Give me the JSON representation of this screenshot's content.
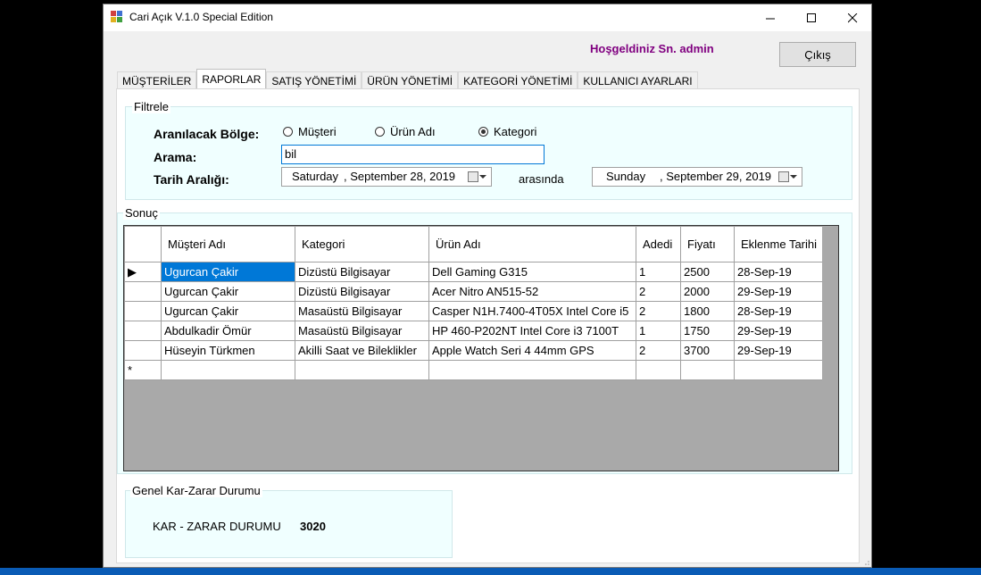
{
  "window": {
    "title": "Cari Açık V.1.0 Special Edition"
  },
  "header": {
    "welcome": "Hoşgeldiniz Sn. admin",
    "exit_label": "Çıkış"
  },
  "tabs": [
    {
      "label": "MÜŞTERİLER"
    },
    {
      "label": "RAPORLAR"
    },
    {
      "label": "SATIŞ YÖNETİMİ"
    },
    {
      "label": "ÜRÜN YÖNETİMİ"
    },
    {
      "label": "KATEGORİ YÖNETİMİ"
    },
    {
      "label": "KULLANICI AYARLARI"
    }
  ],
  "active_tab": "RAPORLAR",
  "filter": {
    "title": "Filtrele",
    "region_label": "Aranılacak Bölge:",
    "radio_customer": "Müşteri",
    "radio_product": "Ürün Adı",
    "radio_category": "Kategori",
    "selected_radio": "Kategori",
    "search_label": "Arama:",
    "search_value": "bil",
    "date_label": "Tarih Aralığı:",
    "date_from_day": "Saturday",
    "date_from_rest": ", September 28, 2019",
    "between_label": "arasında",
    "date_to_day": "Sunday",
    "date_to_rest": ", September 29, 2019"
  },
  "results": {
    "title": "Sonuç",
    "columns": [
      "Müşteri Adı",
      "Kategori",
      "Ürün Adı",
      "Adedi",
      "Fiyatı",
      "Eklenme Tarihi"
    ],
    "rows": [
      [
        "Ugurcan Çakir",
        "Dizüstü Bilgisayar",
        "Dell Gaming G315",
        "1",
        "2500",
        "28-Sep-19"
      ],
      [
        "Ugurcan Çakir",
        "Dizüstü Bilgisayar",
        "Acer Nitro AN515-52",
        "2",
        "2000",
        "29-Sep-19"
      ],
      [
        "Ugurcan Çakir",
        "Masaüstü Bilgisayar",
        "Casper N1H.7400-4T05X Intel Core i5",
        "2",
        "1800",
        "28-Sep-19"
      ],
      [
        "Abdulkadir Ömür",
        "Masaüstü Bilgisayar",
        "HP 460-P202NT Intel Core i3 7100T",
        "1",
        "1750",
        "29-Sep-19"
      ],
      [
        "Hüseyin Türkmen",
        "Akilli Saat ve Bileklikler",
        "Apple Watch Seri 4 44mm GPS",
        "2",
        "3700",
        "29-Sep-19"
      ]
    ],
    "current_row_marker": "▶",
    "new_row_marker": "*"
  },
  "summary": {
    "title": "Genel Kar-Zarar Durumu",
    "label": "KAR - ZARAR DURUMU",
    "value": "3020"
  },
  "colors": {
    "accent": "#0078d7",
    "welcome": "#800080",
    "groupbox_bg": "#f0ffff",
    "grid_bg": "#a9a9a9"
  }
}
